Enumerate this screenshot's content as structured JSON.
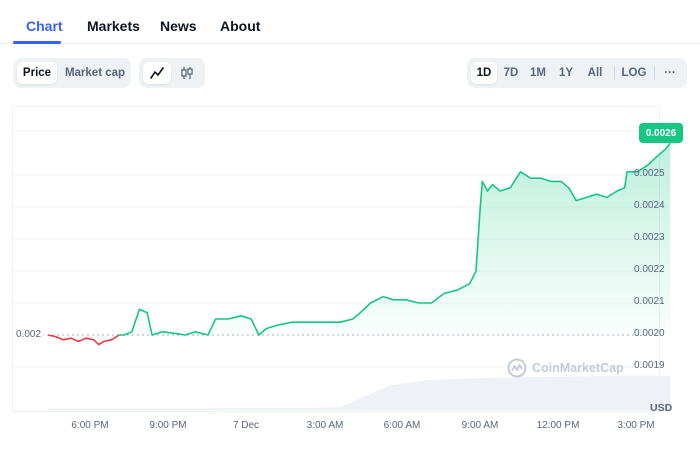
{
  "tabs": [
    {
      "label": "Chart",
      "active": true
    },
    {
      "label": "Markets",
      "active": false
    },
    {
      "label": "News",
      "active": false
    },
    {
      "label": "About",
      "active": false
    }
  ],
  "metric_toggle": {
    "options": [
      "Price",
      "Market cap"
    ],
    "selected": "Price"
  },
  "chart_style_toggle": {
    "options": [
      "line-chart-icon",
      "candlestick-icon"
    ],
    "selected": "line-chart-icon"
  },
  "range_toggle": {
    "options": [
      "1D",
      "7D",
      "1M",
      "1Y",
      "All"
    ],
    "selected": "1D",
    "log_label": "LOG",
    "more_label": "···"
  },
  "colors": {
    "accent": "#3861fb",
    "up": "#16c784",
    "down": "#ea3943"
  },
  "chart": {
    "current_price_badge": "0.0026",
    "reference_price_label": "0.002",
    "currency": "USD",
    "watermark": "CoinMarketCap",
    "y_ticks": [
      "0.0025",
      "0.0024",
      "0.0023",
      "0.0022",
      "0.0021",
      "0.0020",
      "0.0019"
    ],
    "x_ticks": [
      "6:00 PM",
      "9:00 PM",
      "7 Dec",
      "3:00 AM",
      "6:00 AM",
      "9:00 AM",
      "12:00 PM",
      "3:00 PM"
    ]
  },
  "chart_data": {
    "type": "area",
    "x_unit": "hours since 4:30 PM (6 Dec)",
    "ylim": [
      0.00185,
      0.00265
    ],
    "reference_line": 0.002,
    "grid": true,
    "y_axis_position": "right",
    "series": [
      {
        "points": [
          [
            0.0,
            0.002
          ],
          [
            0.3,
            0.001995
          ],
          [
            0.6,
            0.001985
          ],
          [
            0.9,
            0.00199
          ],
          [
            1.2,
            0.00198
          ],
          [
            1.5,
            0.00199
          ],
          [
            1.8,
            0.001985
          ],
          [
            2.0,
            0.00197
          ],
          [
            2.2,
            0.00198
          ],
          [
            2.5,
            0.001985
          ],
          [
            2.8,
            0.002
          ],
          [
            3.0,
            0.002
          ],
          [
            3.3,
            0.00201
          ],
          [
            3.6,
            0.00208
          ],
          [
            3.9,
            0.00207
          ],
          [
            4.1,
            0.002
          ],
          [
            4.5,
            0.00201
          ],
          [
            5.0,
            0.002005
          ],
          [
            5.4,
            0.002
          ],
          [
            5.8,
            0.00201
          ],
          [
            6.3,
            0.002
          ],
          [
            6.6,
            0.00205
          ],
          [
            7.1,
            0.00205
          ],
          [
            7.6,
            0.00206
          ],
          [
            8.0,
            0.00205
          ],
          [
            8.3,
            0.002
          ],
          [
            8.6,
            0.00202
          ],
          [
            9.0,
            0.00203
          ],
          [
            9.6,
            0.00204
          ],
          [
            10.3,
            0.00204
          ],
          [
            11.0,
            0.00204
          ],
          [
            11.5,
            0.00204
          ],
          [
            12.0,
            0.00205
          ],
          [
            12.3,
            0.00207
          ],
          [
            12.7,
            0.0021
          ],
          [
            13.2,
            0.00212
          ],
          [
            13.6,
            0.00211
          ],
          [
            14.1,
            0.00211
          ],
          [
            14.6,
            0.0021
          ],
          [
            15.1,
            0.0021
          ],
          [
            15.6,
            0.00213
          ],
          [
            16.1,
            0.00214
          ],
          [
            16.6,
            0.00216
          ],
          [
            16.85,
            0.0022
          ],
          [
            17.0,
            0.00238
          ],
          [
            17.1,
            0.00248
          ],
          [
            17.3,
            0.00245
          ],
          [
            17.5,
            0.00247
          ],
          [
            17.8,
            0.00245
          ],
          [
            18.2,
            0.00246
          ],
          [
            18.6,
            0.00251
          ],
          [
            19.0,
            0.00249
          ],
          [
            19.4,
            0.00249
          ],
          [
            19.8,
            0.00248
          ],
          [
            20.2,
            0.00248
          ],
          [
            20.5,
            0.00246
          ],
          [
            20.8,
            0.00242
          ],
          [
            21.2,
            0.00243
          ],
          [
            21.6,
            0.00244
          ],
          [
            22.0,
            0.00243
          ],
          [
            22.4,
            0.00245
          ],
          [
            22.7,
            0.00246
          ],
          [
            22.8,
            0.00251
          ],
          [
            23.2,
            0.00251
          ],
          [
            23.6,
            0.00253
          ],
          [
            24.0,
            0.00256
          ],
          [
            24.3,
            0.00258
          ],
          [
            24.5,
            0.0026
          ]
        ]
      }
    ],
    "volume": [
      [
        0,
        0.04
      ],
      [
        2,
        0.04
      ],
      [
        4,
        0.04
      ],
      [
        6,
        0.04
      ],
      [
        8,
        0.05
      ],
      [
        10,
        0.05
      ],
      [
        11.5,
        0.07
      ],
      [
        12.5,
        0.35
      ],
      [
        13.5,
        0.62
      ],
      [
        15,
        0.75
      ],
      [
        17,
        0.8
      ],
      [
        19,
        0.82
      ],
      [
        21,
        0.84
      ],
      [
        23,
        0.86
      ],
      [
        24.5,
        0.86
      ]
    ]
  }
}
